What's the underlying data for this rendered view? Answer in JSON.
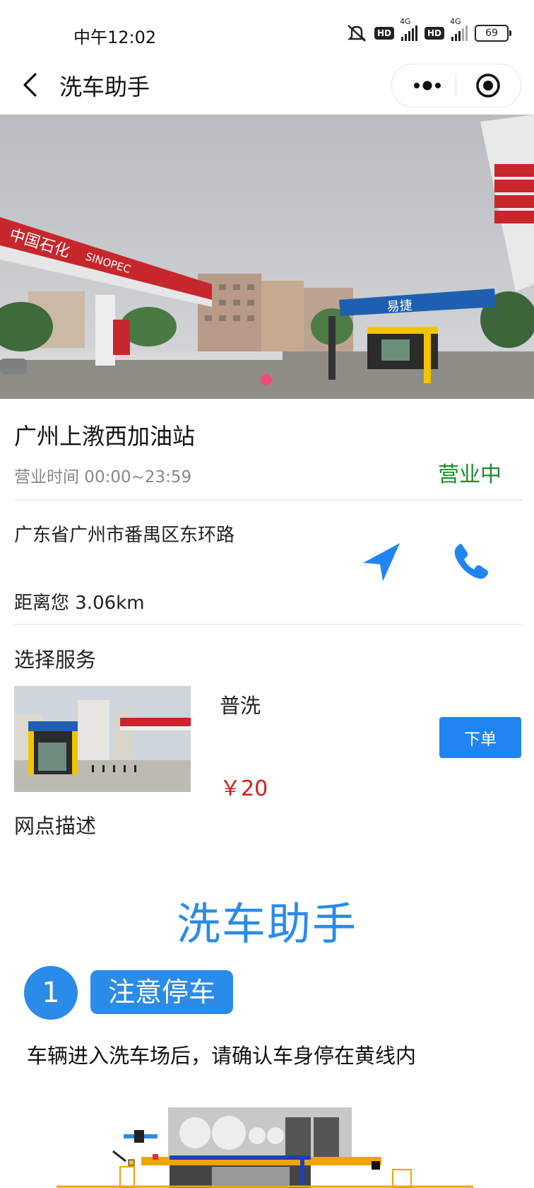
{
  "status_bar": {
    "time": "中午12:02",
    "network_1": "4G",
    "network_2": "4G",
    "hd_1": "HD",
    "hd_2": "HD",
    "battery": "69",
    "icons": [
      "mute-icon",
      "signal-icon",
      "battery-icon"
    ]
  },
  "nav": {
    "title": "洗车助手",
    "icons": [
      "back-icon",
      "more-icon",
      "target-icon"
    ]
  },
  "hero": {
    "carousel_active_index": 1
  },
  "station": {
    "name": "广州上漖西加油站",
    "hours": "营业时间 00:00~23:59",
    "status": "营业中",
    "status_color": "#1b8a2b",
    "address": "广东省广州市番禺区东环路",
    "distance": "距离您 3.06km"
  },
  "service": {
    "header": "选择服务",
    "items": [
      {
        "name": "普洗",
        "price": "￥20",
        "order_label": "下单"
      }
    ]
  },
  "description": {
    "header": "网点描述",
    "poster_title": "洗车助手",
    "step_number": "1",
    "step_label": "注意停车",
    "step_text": "车辆进入洗车场后，请确认车身停在黄线内"
  },
  "colors": {
    "accent": "#2a8be8",
    "button": "#2085f3",
    "price": "#d71a1a"
  }
}
